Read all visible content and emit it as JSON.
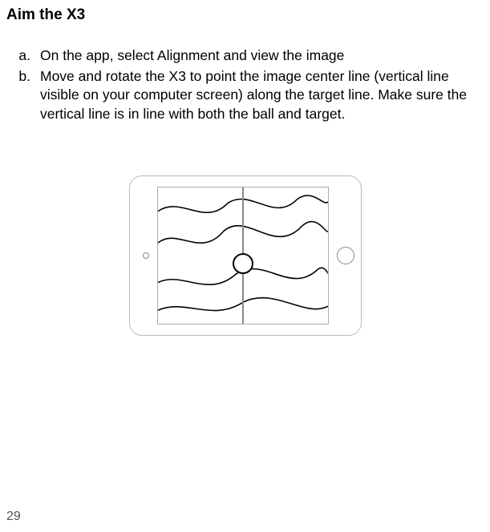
{
  "heading": "Aim the X3",
  "list": [
    {
      "marker": "a.",
      "text": "On the app, select Alignment and view the image"
    },
    {
      "marker": "b.",
      "text": "Move and rotate the X3 to point the image center line (vertical line visible on your computer screen) along the target line. Make sure the vertical line is in line with both the  ball and target."
    }
  ],
  "pageNumber": "29"
}
